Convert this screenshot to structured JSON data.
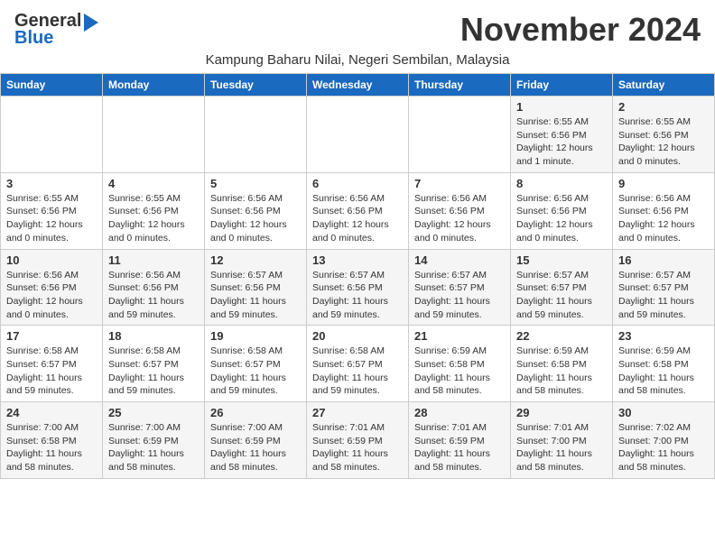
{
  "header": {
    "logo_general": "General",
    "logo_blue": "Blue",
    "month_title": "November 2024",
    "subtitle": "Kampung Baharu Nilai, Negeri Sembilan, Malaysia"
  },
  "calendar": {
    "days_of_week": [
      "Sunday",
      "Monday",
      "Tuesday",
      "Wednesday",
      "Thursday",
      "Friday",
      "Saturday"
    ],
    "weeks": [
      [
        {
          "day": "",
          "info": ""
        },
        {
          "day": "",
          "info": ""
        },
        {
          "day": "",
          "info": ""
        },
        {
          "day": "",
          "info": ""
        },
        {
          "day": "",
          "info": ""
        },
        {
          "day": "1",
          "info": "Sunrise: 6:55 AM\nSunset: 6:56 PM\nDaylight: 12 hours and 1 minute."
        },
        {
          "day": "2",
          "info": "Sunrise: 6:55 AM\nSunset: 6:56 PM\nDaylight: 12 hours and 0 minutes."
        }
      ],
      [
        {
          "day": "3",
          "info": "Sunrise: 6:55 AM\nSunset: 6:56 PM\nDaylight: 12 hours and 0 minutes."
        },
        {
          "day": "4",
          "info": "Sunrise: 6:55 AM\nSunset: 6:56 PM\nDaylight: 12 hours and 0 minutes."
        },
        {
          "day": "5",
          "info": "Sunrise: 6:56 AM\nSunset: 6:56 PM\nDaylight: 12 hours and 0 minutes."
        },
        {
          "day": "6",
          "info": "Sunrise: 6:56 AM\nSunset: 6:56 PM\nDaylight: 12 hours and 0 minutes."
        },
        {
          "day": "7",
          "info": "Sunrise: 6:56 AM\nSunset: 6:56 PM\nDaylight: 12 hours and 0 minutes."
        },
        {
          "day": "8",
          "info": "Sunrise: 6:56 AM\nSunset: 6:56 PM\nDaylight: 12 hours and 0 minutes."
        },
        {
          "day": "9",
          "info": "Sunrise: 6:56 AM\nSunset: 6:56 PM\nDaylight: 12 hours and 0 minutes."
        }
      ],
      [
        {
          "day": "10",
          "info": "Sunrise: 6:56 AM\nSunset: 6:56 PM\nDaylight: 12 hours and 0 minutes."
        },
        {
          "day": "11",
          "info": "Sunrise: 6:56 AM\nSunset: 6:56 PM\nDaylight: 11 hours and 59 minutes."
        },
        {
          "day": "12",
          "info": "Sunrise: 6:57 AM\nSunset: 6:56 PM\nDaylight: 11 hours and 59 minutes."
        },
        {
          "day": "13",
          "info": "Sunrise: 6:57 AM\nSunset: 6:56 PM\nDaylight: 11 hours and 59 minutes."
        },
        {
          "day": "14",
          "info": "Sunrise: 6:57 AM\nSunset: 6:57 PM\nDaylight: 11 hours and 59 minutes."
        },
        {
          "day": "15",
          "info": "Sunrise: 6:57 AM\nSunset: 6:57 PM\nDaylight: 11 hours and 59 minutes."
        },
        {
          "day": "16",
          "info": "Sunrise: 6:57 AM\nSunset: 6:57 PM\nDaylight: 11 hours and 59 minutes."
        }
      ],
      [
        {
          "day": "17",
          "info": "Sunrise: 6:58 AM\nSunset: 6:57 PM\nDaylight: 11 hours and 59 minutes."
        },
        {
          "day": "18",
          "info": "Sunrise: 6:58 AM\nSunset: 6:57 PM\nDaylight: 11 hours and 59 minutes."
        },
        {
          "day": "19",
          "info": "Sunrise: 6:58 AM\nSunset: 6:57 PM\nDaylight: 11 hours and 59 minutes."
        },
        {
          "day": "20",
          "info": "Sunrise: 6:58 AM\nSunset: 6:57 PM\nDaylight: 11 hours and 59 minutes."
        },
        {
          "day": "21",
          "info": "Sunrise: 6:59 AM\nSunset: 6:58 PM\nDaylight: 11 hours and 58 minutes."
        },
        {
          "day": "22",
          "info": "Sunrise: 6:59 AM\nSunset: 6:58 PM\nDaylight: 11 hours and 58 minutes."
        },
        {
          "day": "23",
          "info": "Sunrise: 6:59 AM\nSunset: 6:58 PM\nDaylight: 11 hours and 58 minutes."
        }
      ],
      [
        {
          "day": "24",
          "info": "Sunrise: 7:00 AM\nSunset: 6:58 PM\nDaylight: 11 hours and 58 minutes."
        },
        {
          "day": "25",
          "info": "Sunrise: 7:00 AM\nSunset: 6:59 PM\nDaylight: 11 hours and 58 minutes."
        },
        {
          "day": "26",
          "info": "Sunrise: 7:00 AM\nSunset: 6:59 PM\nDaylight: 11 hours and 58 minutes."
        },
        {
          "day": "27",
          "info": "Sunrise: 7:01 AM\nSunset: 6:59 PM\nDaylight: 11 hours and 58 minutes."
        },
        {
          "day": "28",
          "info": "Sunrise: 7:01 AM\nSunset: 6:59 PM\nDaylight: 11 hours and 58 minutes."
        },
        {
          "day": "29",
          "info": "Sunrise: 7:01 AM\nSunset: 7:00 PM\nDaylight: 11 hours and 58 minutes."
        },
        {
          "day": "30",
          "info": "Sunrise: 7:02 AM\nSunset: 7:00 PM\nDaylight: 11 hours and 58 minutes."
        }
      ]
    ]
  }
}
